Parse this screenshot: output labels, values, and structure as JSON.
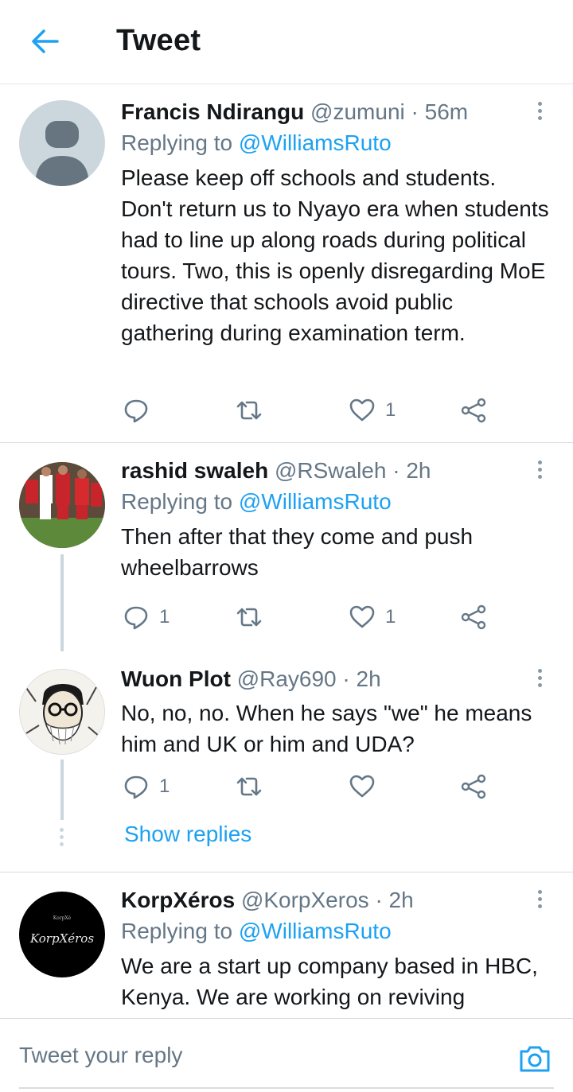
{
  "header": {
    "title": "Tweet"
  },
  "tweets": [
    {
      "name": "Francis Ndirangu",
      "handle": "@zumuni",
      "time": "· 56m",
      "replying_prefix": "Replying to",
      "replying_to": "@WilliamsRuto",
      "text": "Please keep off schools and students. Don't return us to Nyayo era when students had to line up along roads during political tours. Two, this is openly disregarding MoE directive that schools avoid public gathering during examination term.",
      "replies": "",
      "likes": "1"
    },
    {
      "name": "rashid swaleh",
      "handle": "@RSwaleh",
      "time": "· 2h",
      "replying_prefix": "Replying to",
      "replying_to": "@WilliamsRuto",
      "text": "Then after that they come and push wheelbarrows",
      "replies": "1",
      "likes": "1"
    },
    {
      "name": "Wuon Plot",
      "handle": "@Ray690",
      "time": "· 2h",
      "text": "No, no, no. When he says \"we\" he means him and UK or him and UDA?",
      "replies": "1",
      "likes": ""
    },
    {
      "name": "KorpXéros",
      "handle": "@KorpXeros",
      "time": "· 2h",
      "replying_prefix": "Replying to",
      "replying_to": "@WilliamsRuto",
      "text": "We are a start up company based in HBC, Kenya. We are working on reviving",
      "avatar_logo_text": "KorpXéros",
      "avatar_logo_small": "KorpXé"
    }
  ],
  "show_replies": "Show replies",
  "compose": {
    "placeholder": "Tweet your reply"
  },
  "colors": {
    "accent": "#1da1f2",
    "muted": "#657786",
    "icon": "#657786",
    "divider": "#e1e8ed"
  },
  "icons": {
    "back": "arrow-left-icon",
    "more": "more-vertical-icon",
    "reply": "reply-bubble-icon",
    "retweet": "retweet-icon",
    "like": "heart-icon",
    "share": "share-icon",
    "camera": "camera-icon"
  }
}
